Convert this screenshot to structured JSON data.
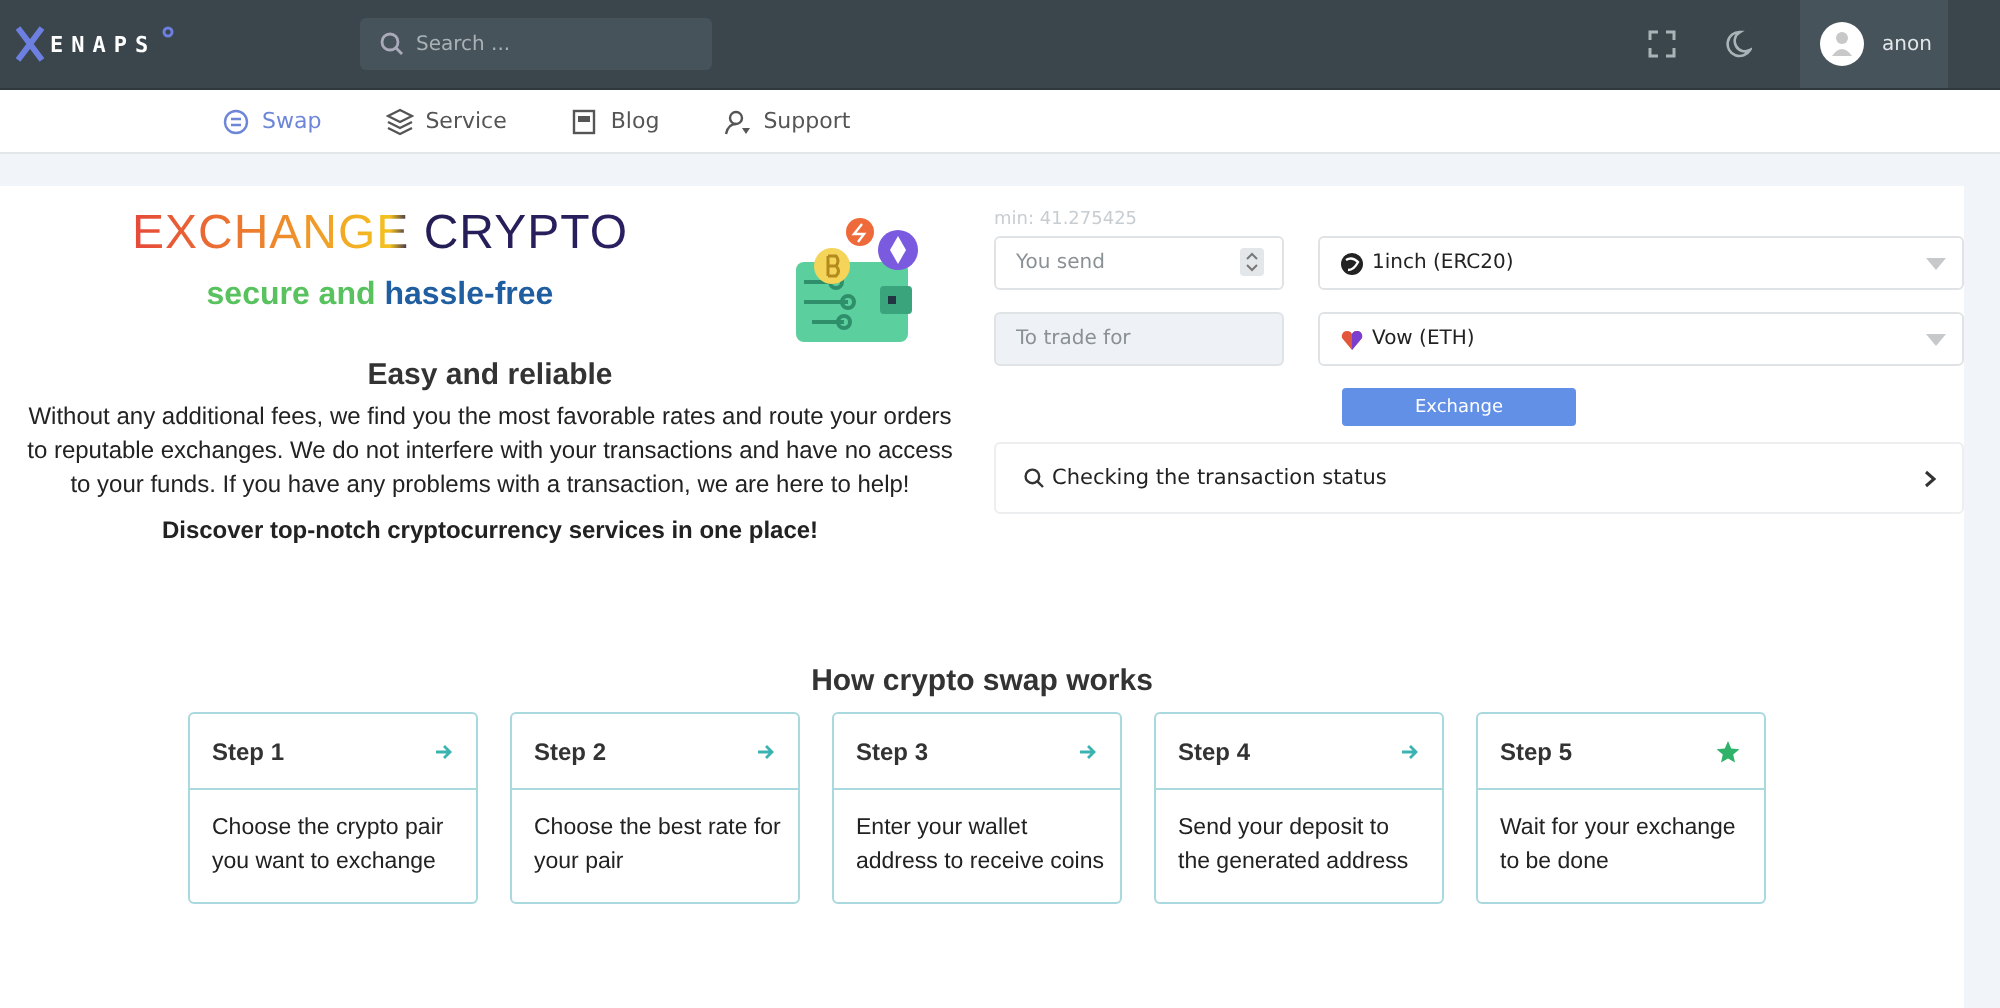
{
  "header": {
    "logo": "ENAPS",
    "search": {
      "placeholder": "Search ..."
    },
    "user": {
      "name": "anon"
    }
  },
  "nav": [
    {
      "label": "Swap",
      "selected": true,
      "kind": "swap"
    },
    {
      "label": "Service",
      "selected": false,
      "kind": "layers"
    },
    {
      "label": "Blog",
      "selected": false,
      "kind": "blog"
    },
    {
      "label": "Support",
      "selected": false,
      "kind": "support"
    }
  ],
  "hero": {
    "title": "EXCHANGE CRYPTO",
    "tagline_start": "secure and",
    "tagline_end": "hassle-free",
    "heading": "Easy and reliable",
    "body": "Without any additional fees, we find you the most favorable rates and route your orders to reputable exchanges. We do not interfere with your transactions and have no access to your funds. If you have any problems with a transaction, we are here to help!",
    "tagline_bold": "Discover top-notch cryptocurrency services in one place!"
  },
  "form": {
    "min": "min: 41.275425",
    "send": {
      "placeholder": "You send"
    },
    "send_currency": "1inch (ERC20)",
    "receive": {
      "placeholder": "To trade for"
    },
    "receive_currency": "Vow (ETH)",
    "button": "Exchange",
    "status": "Checking the transaction status"
  },
  "steps_title": "How crypto swap works",
  "steps": [
    {
      "title": "Step 1",
      "text": "Choose the crypto pair you want to exchange",
      "kind": "arrow"
    },
    {
      "title": "Step 2",
      "text": "Choose the best rate for your pair",
      "kind": "arrow"
    },
    {
      "title": "Step 3",
      "text": "Enter your wallet address to receive coins",
      "kind": "arrow"
    },
    {
      "title": "Step 4",
      "text": "Send your deposit to the generated address",
      "kind": "arrow"
    },
    {
      "title": "Step 5",
      "text": "Wait for your exchange to be done",
      "kind": "star"
    }
  ]
}
